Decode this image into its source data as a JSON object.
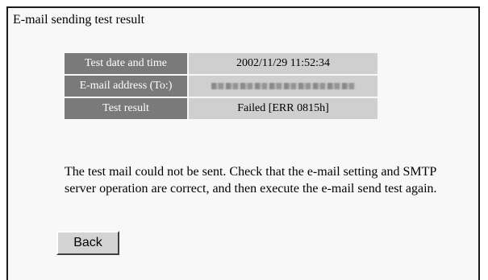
{
  "page": {
    "title": "E-mail sending test result"
  },
  "result_table": {
    "rows": [
      {
        "label": "Test date and time",
        "value": "2002/11/29 11:52:34"
      },
      {
        "label": "E-mail address (To:)",
        "value": ""
      },
      {
        "label": "Test result",
        "value": "Failed [ERR 0815h]"
      }
    ]
  },
  "message": "The test mail could not be sent. Check that the e-mail setting and SMTP server operation are correct, and then execute the e-mail send test again.",
  "buttons": {
    "back_label": "Back"
  }
}
